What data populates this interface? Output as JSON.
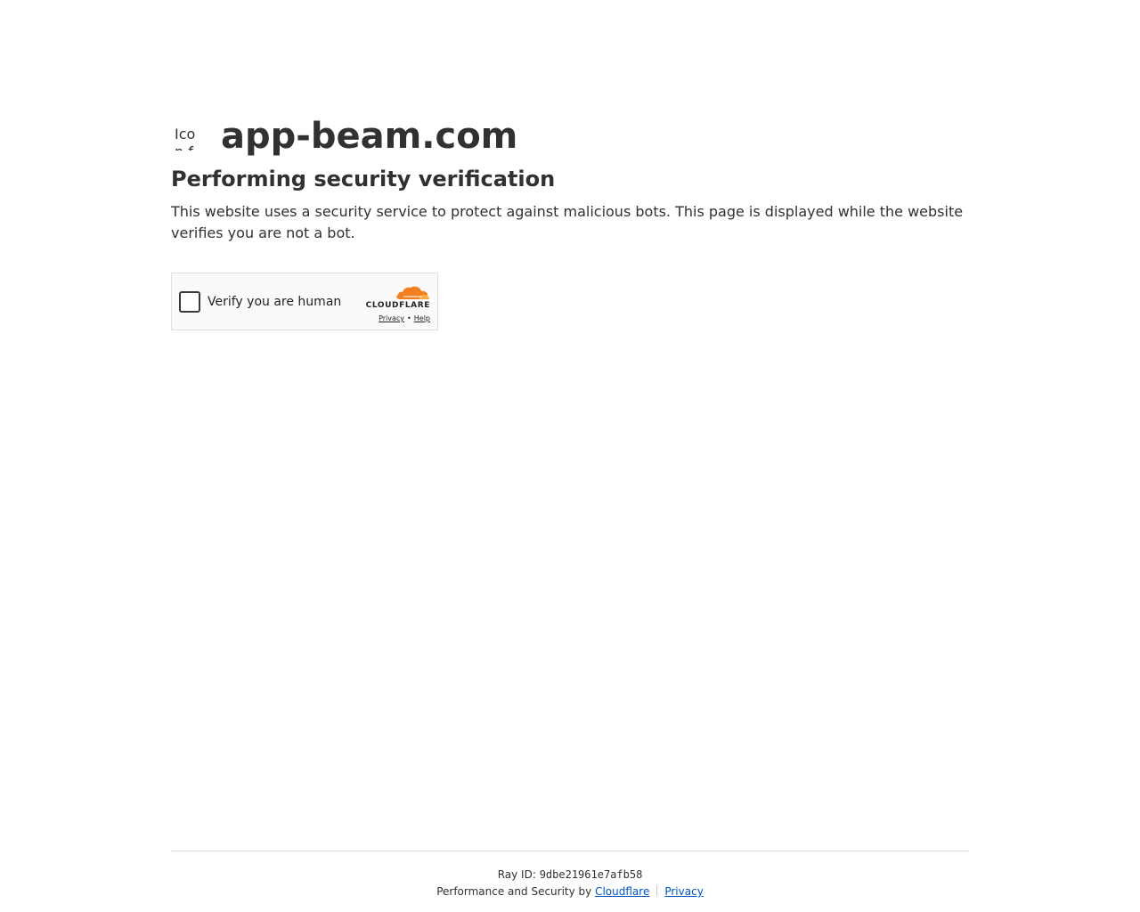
{
  "site": {
    "favicon_alt": "Icon for app-beam.com",
    "name": "app-beam.com"
  },
  "main": {
    "heading": "Performing security verification",
    "description": "This website uses a security service to protect against malicious bots. This page is displayed while the website verifies you are not a bot."
  },
  "challenge": {
    "checkbox_label": "Verify you are human",
    "checked": false,
    "brand": "CLOUDFLARE",
    "privacy_link": "Privacy",
    "separator": "•",
    "help_link": "Help",
    "brand_colors": {
      "orange": "#f38020",
      "light_orange": "#faae40"
    }
  },
  "footer": {
    "ray_label": "Ray ID:",
    "ray_id": "9dbe21961e7afb58",
    "performance_text": "Performance and Security by",
    "cloudflare_link": "Cloudflare",
    "privacy_link": "Privacy"
  }
}
